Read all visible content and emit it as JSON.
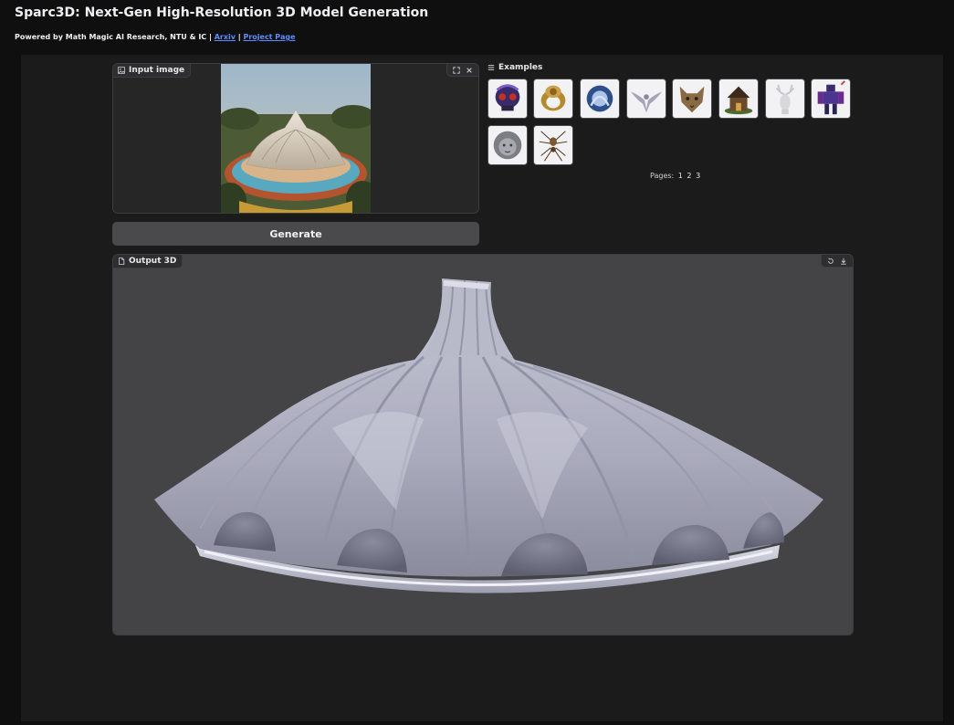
{
  "header": {
    "title": "Sparc3D: Next-Gen High-Resolution 3D Model Generation",
    "subtitle_prefix": "Powered by Math Magic AI Research, NTU & IC |",
    "arxiv_link": "Arxiv",
    "separator": "|",
    "project_link": "Project Page"
  },
  "input_image": {
    "label": "Input image",
    "icons": [
      "fullscreen-icon",
      "close-icon"
    ]
  },
  "generate_button": {
    "label": "Generate"
  },
  "examples": {
    "label": "Examples",
    "items": [
      "skull",
      "ring",
      "dragon-disc",
      "eagle",
      "wolf",
      "house",
      "deer",
      "robot",
      "lion",
      "spider"
    ],
    "pages_label": "Pages:",
    "pages": [
      "1",
      "2",
      "3"
    ]
  },
  "output": {
    "label": "Output 3D",
    "icons": [
      "reset-icon",
      "download-icon"
    ]
  },
  "colors": {
    "background": "#0f0f10",
    "panel": "#1b1b1c",
    "viewer": "#444446",
    "link": "#5a8dff",
    "button": "#4a4a4c"
  }
}
